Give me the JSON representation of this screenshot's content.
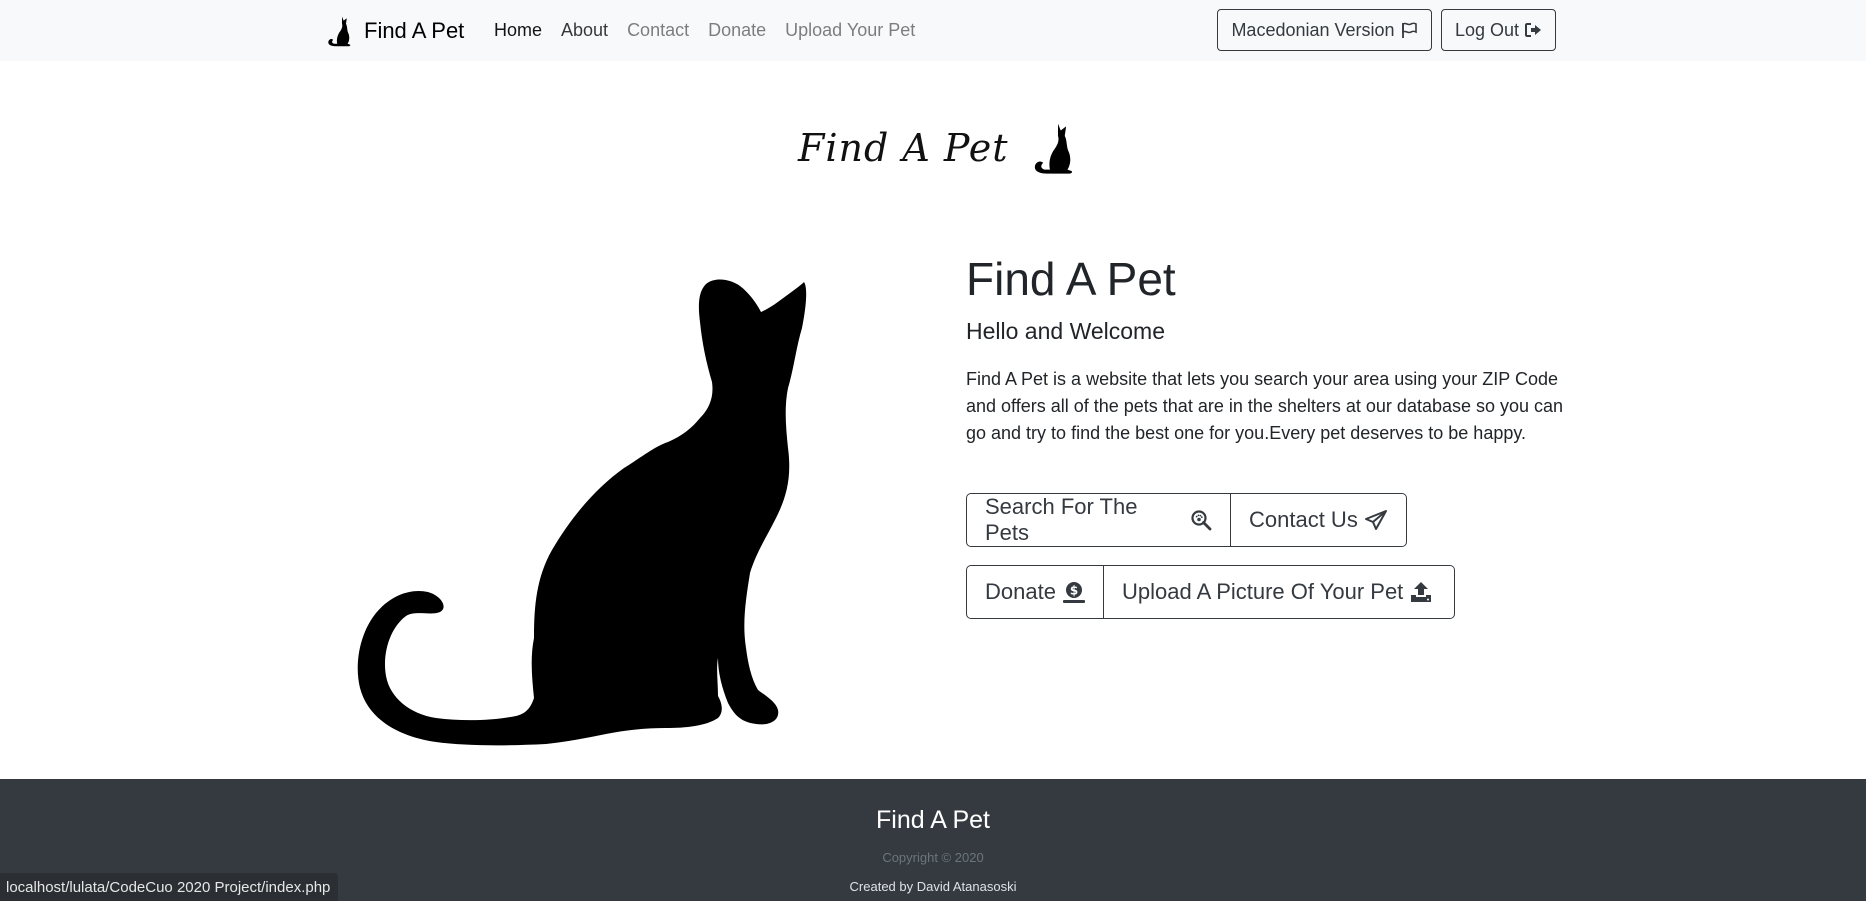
{
  "navbar": {
    "brand": "Find A Pet",
    "links": [
      {
        "label": "Home"
      },
      {
        "label": "About"
      },
      {
        "label": "Contact"
      },
      {
        "label": "Donate"
      },
      {
        "label": "Upload Your Pet"
      }
    ],
    "language_button": "Macedonian Version",
    "logout_button": "Log Out"
  },
  "logo": {
    "text": "Find A Pet"
  },
  "hero": {
    "title": "Find A Pet",
    "subtitle": "Hello and Welcome",
    "description": "Find A Pet is a website that lets you search your area using your ZIP Code and offers all of the pets that are in the shelters at our database so you can go and try to find the best one for you.Every pet deserves to be happy.",
    "buttons": {
      "search": "Search For The Pets",
      "contact": "Contact Us",
      "donate": "Donate",
      "upload": "Upload A Picture Of Your Pet"
    }
  },
  "footer": {
    "title": "Find A Pet",
    "copyright": "Copyright © 2020",
    "author": "Created by David Atanasoski"
  },
  "status_bar": {
    "url": "localhost/lulata/CodeCuo 2020 Project/index.php"
  },
  "colors": {
    "navbar_bg": "#f8f9fa",
    "footer_bg": "#343a40",
    "button_outline": "#343a40",
    "text": "#212529"
  },
  "icons": {
    "brand": "cat-silhouette-icon",
    "language": "flag-icon",
    "logout": "sign-out-icon",
    "search": "search-paw-icon",
    "contact": "paper-plane-icon",
    "donate": "coin-dollar-icon",
    "upload": "upload-icon"
  }
}
